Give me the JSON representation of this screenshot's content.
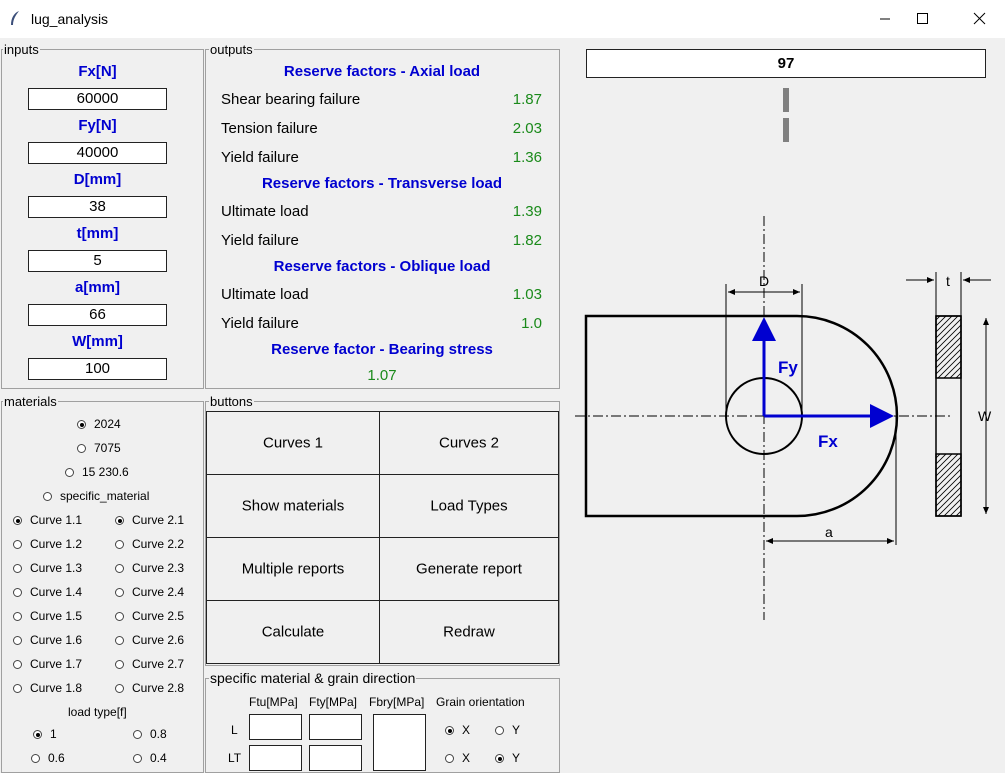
{
  "window": {
    "title": "lug_analysis"
  },
  "inputs": {
    "label": "inputs",
    "fields": [
      {
        "label": "Fx[N]",
        "value": "60000"
      },
      {
        "label": "Fy[N]",
        "value": "40000"
      },
      {
        "label": "D[mm]",
        "value": "38"
      },
      {
        "label": "t[mm]",
        "value": "5"
      },
      {
        "label": "a[mm]",
        "value": "66"
      },
      {
        "label": "W[mm]",
        "value": "100"
      }
    ]
  },
  "outputs": {
    "label": "outputs",
    "axial": {
      "header": "Reserve factors - Axial load",
      "rows": [
        {
          "name": "Shear bearing failure",
          "value": "1.87"
        },
        {
          "name": "Tension failure",
          "value": "2.03"
        },
        {
          "name": "Yield failure",
          "value": "1.36"
        }
      ]
    },
    "transverse": {
      "header": "Reserve factors - Transverse load",
      "rows": [
        {
          "name": "Ultimate load",
          "value": "1.39"
        },
        {
          "name": "Yield failure",
          "value": "1.82"
        }
      ]
    },
    "oblique": {
      "header": "Reserve factors - Oblique load",
      "rows": [
        {
          "name": "Ultimate load",
          "value": "1.03"
        },
        {
          "name": "Yield failure",
          "value": "1.0"
        }
      ]
    },
    "bearing": {
      "header": "Reserve factor - Bearing stress",
      "value": "1.07"
    }
  },
  "progress": {
    "value": "97"
  },
  "materials": {
    "label": "materials",
    "options": [
      "2024",
      "7075",
      "15 230.6",
      "specific_material"
    ],
    "selected": "2024",
    "curves1": [
      "Curve 1.1",
      "Curve 1.2",
      "Curve 1.3",
      "Curve 1.4",
      "Curve 1.5",
      "Curve 1.6",
      "Curve 1.7",
      "Curve 1.8"
    ],
    "curves2": [
      "Curve 2.1",
      "Curve 2.2",
      "Curve 2.3",
      "Curve 2.4",
      "Curve 2.5",
      "Curve 2.6",
      "Curve 2.7",
      "Curve 2.8"
    ],
    "load_type_label": "load type[f]",
    "load_types": [
      "1",
      "0.8",
      "0.6",
      "0.4"
    ]
  },
  "buttons": {
    "label": "buttons",
    "items": [
      "Curves 1",
      "Curves 2",
      "Show materials",
      "Load Types",
      "Multiple reports",
      "Generate report",
      "Calculate",
      "Redraw"
    ]
  },
  "specific": {
    "label": "specific material & grain direction",
    "col_ftu": "Ftu[MPa]",
    "col_fty": "Fty[MPa]",
    "col_fbry": "Fbry[MPa]",
    "grain_label": "Grain orientation",
    "row_l": "L",
    "row_lt": "LT",
    "x": "X",
    "y": "Y"
  },
  "drawing": {
    "label_d": "D",
    "label_t": "t",
    "label_w": "W",
    "label_a": "a",
    "label_fx": "Fx",
    "label_fy": "Fy"
  },
  "colors": {
    "accent_blue": "#0000d0",
    "value_green": "#1a8a1a"
  }
}
